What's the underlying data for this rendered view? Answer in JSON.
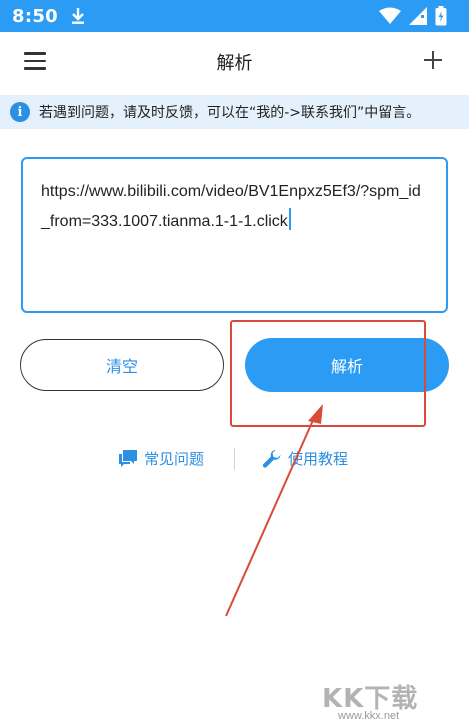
{
  "status_bar": {
    "time": "8:50"
  },
  "app_bar": {
    "title": "解析"
  },
  "notice": {
    "text": "若遇到问题，请及时反馈，可以在“我的->联系我们”中留言。"
  },
  "url_input": {
    "value": "https://www.bilibili.com/video/BV1Enpxz5Ef3/?spm_id_from=333.1007.tianma.1-1-1.click"
  },
  "buttons": {
    "clear_label": "清空",
    "parse_label": "解析"
  },
  "links": {
    "faq_label": "常见问题",
    "tutorial_label": "使用教程"
  },
  "watermark": {
    "logo": "KK下载",
    "url": "www.kkx.net"
  },
  "colors": {
    "accent": "#2b9bf4",
    "annotation": "#d84a3a"
  }
}
